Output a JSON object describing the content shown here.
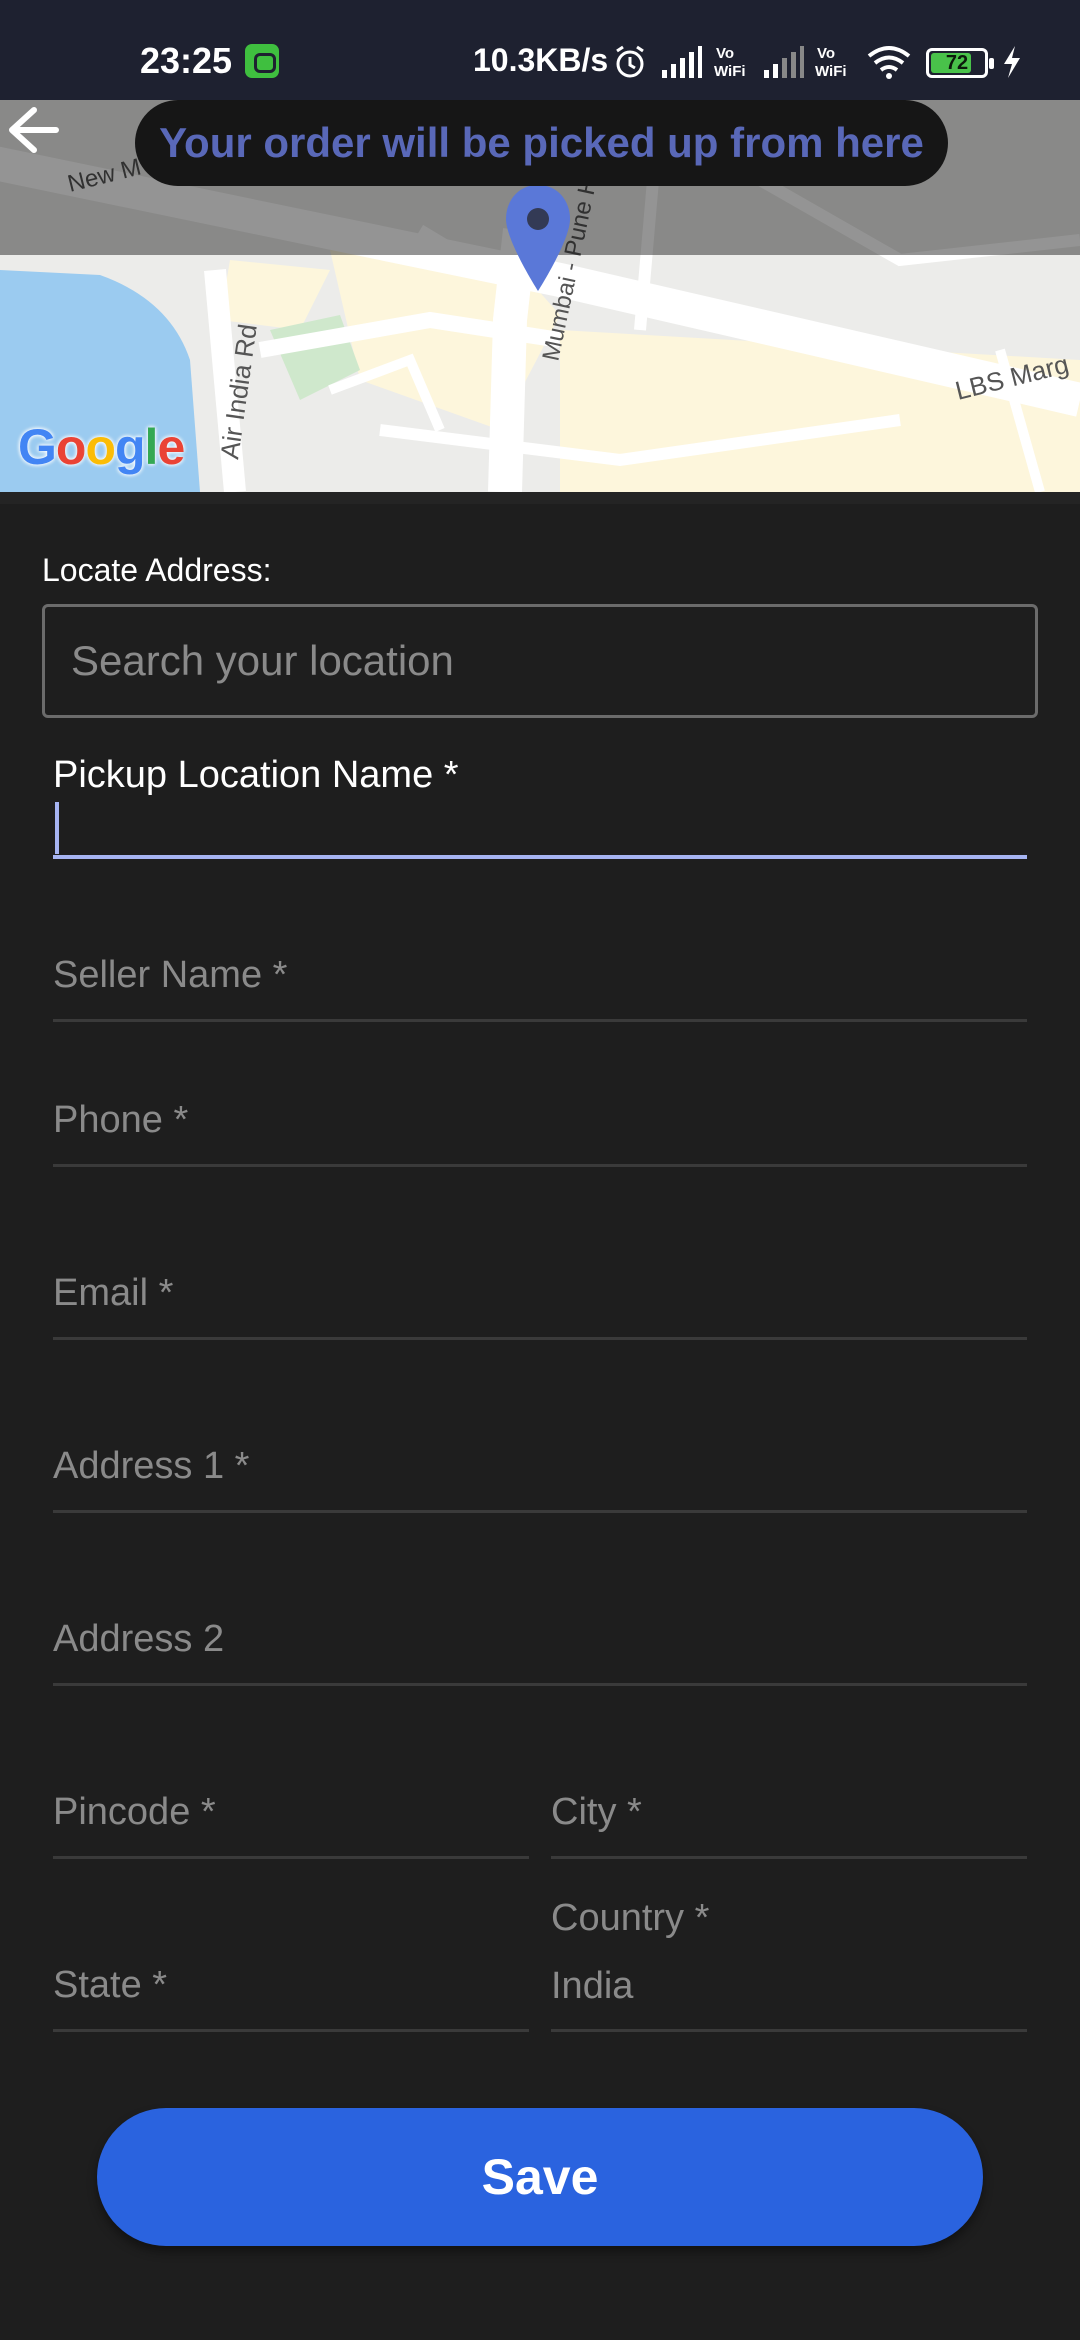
{
  "status_bar": {
    "time": "23:25",
    "network_speed": "10.3KB/s",
    "battery_level": "72",
    "icons": [
      "app-notification-icon",
      "alarm-icon",
      "signal-icon",
      "vowifi-icon",
      "signal-icon",
      "vowifi-icon",
      "wifi-icon",
      "battery-icon",
      "charging-icon"
    ]
  },
  "map": {
    "tooltip": "Your order will be picked up from here",
    "street_labels": [
      "New M",
      "Mumbai - Pune H",
      "Air India Rd",
      "LBS Marg"
    ],
    "google_logo": "Google"
  },
  "form": {
    "locate_label": "Locate Address:",
    "search_placeholder": "Search your location",
    "fields": {
      "pickup_name": "Pickup Location Name *",
      "seller_name": "Seller Name *",
      "phone": "Phone *",
      "email": "Email *",
      "address1": "Address 1 *",
      "address2": "Address 2",
      "pincode": "Pincode *",
      "city": "City *",
      "state": "State *",
      "country": "Country *",
      "country_value": "India"
    },
    "save_label": "Save"
  },
  "colors": {
    "accent": "#2a63df",
    "tooltip_text": "#5968b8",
    "active_underline": "#a6b4f2"
  }
}
